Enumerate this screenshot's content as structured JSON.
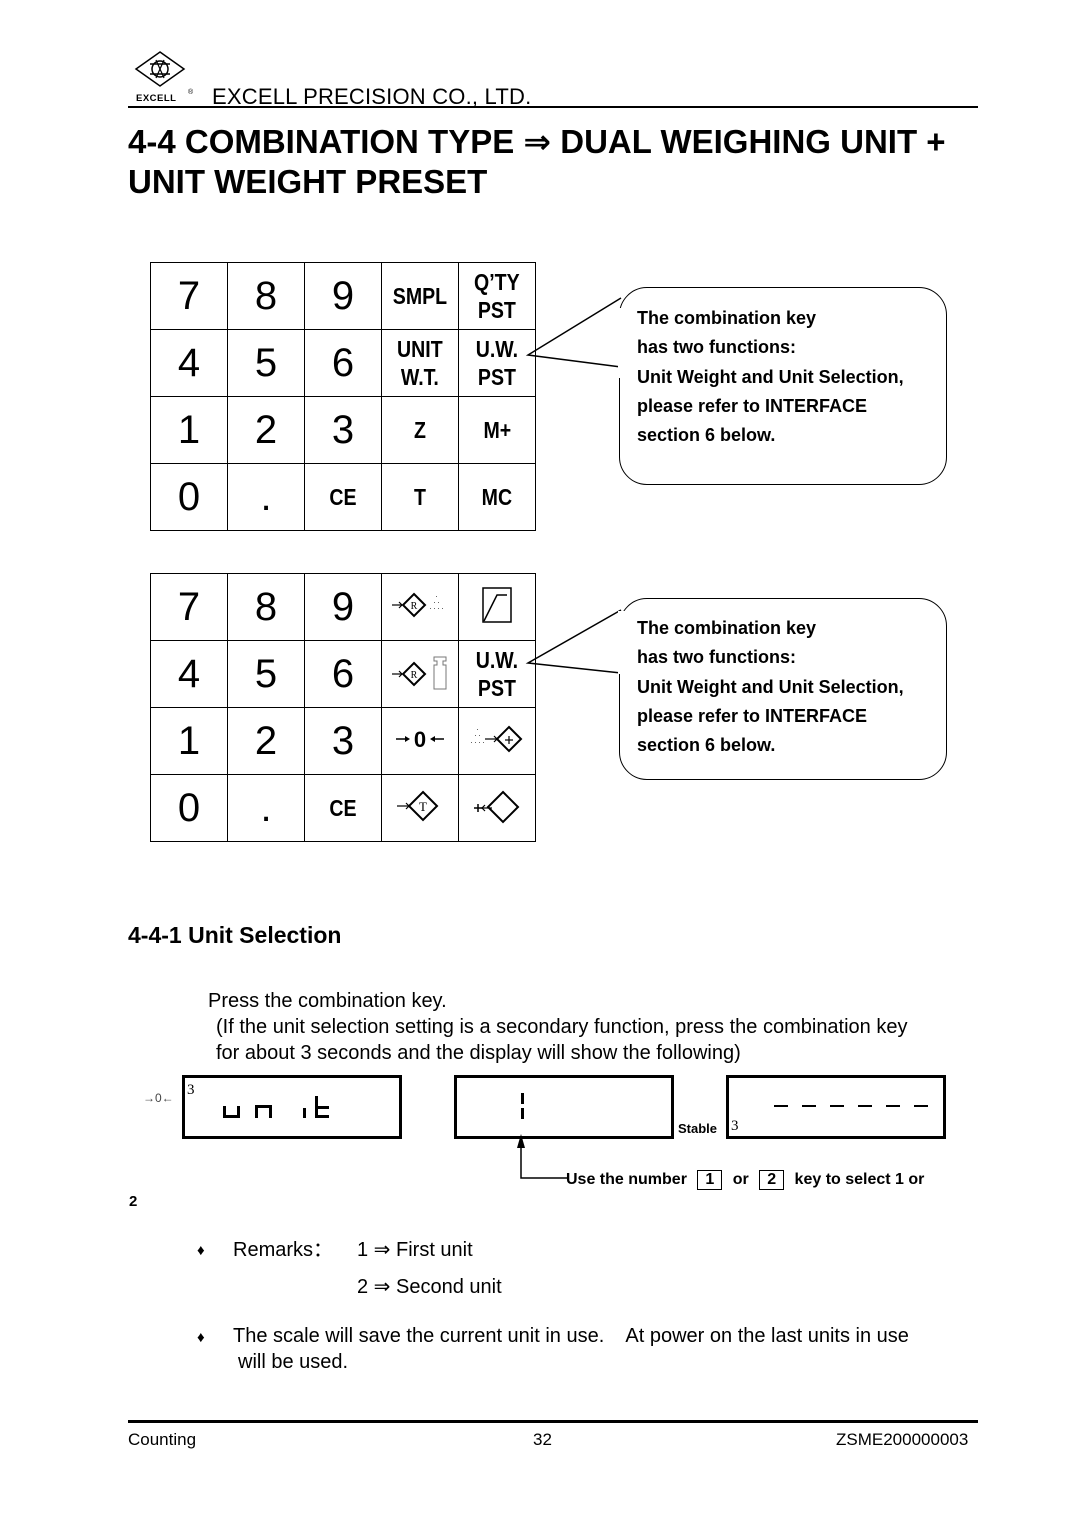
{
  "header": {
    "logo_label": "EXCELL",
    "logo_registered": "®",
    "company": "EXCELL PRECISION CO., LTD."
  },
  "title": "4-4 COMBINATION TYPE ⇒ DUAL WEIGHING UNIT + UNIT WEIGHT PRESET",
  "keypad_text": {
    "rows": [
      [
        "7",
        "8",
        "9",
        "SMPL",
        "Q’TY|PST"
      ],
      [
        "4",
        "5",
        "6",
        "UNIT|W.T.",
        "U.W.|PST"
      ],
      [
        "1",
        "2",
        "3",
        "Z",
        "M+"
      ],
      [
        "0",
        ".",
        "CE",
        "T",
        "MC"
      ]
    ],
    "k_7": "7",
    "k_8": "8",
    "k_9": "9",
    "k_4": "4",
    "k_5": "5",
    "k_6": "6",
    "k_1": "1",
    "k_2": "2",
    "k_3": "3",
    "k_0": "0",
    "k_dot": ".",
    "k_ce": "CE",
    "smpl": "SMPL",
    "qty_line1": "Q’TY",
    "qty_line2": "PST",
    "unit_line1": "UNIT",
    "unit_line2": "W.T.",
    "uw_line1": "U.W.",
    "uw_line2": "PST",
    "z": "Z",
    "mplus": "M+",
    "t": "T",
    "mc": "MC"
  },
  "keypad_icon": {
    "icons": [
      "sample-r-icon",
      "curve-icon",
      "unit-weight-r-icon",
      "zero-icon",
      "accumulate-plus-icon",
      "tare-icon",
      "recall-icon"
    ],
    "k_7": "7",
    "k_8": "8",
    "k_9": "9",
    "k_4": "4",
    "k_5": "5",
    "k_6": "6",
    "k_1": "1",
    "k_2": "2",
    "k_3": "3",
    "k_0": "0",
    "k_dot": ".",
    "k_ce": "CE",
    "uw_line1": "U.W.",
    "uw_line2": "PST",
    "r_letter": "R",
    "t_letter": "T",
    "zero_text": "0"
  },
  "callouts": [
    {
      "lines": [
        "The combination key",
        "has two functions:",
        "Unit Weight and Unit Selection,",
        "please refer to INTERFACE",
        "section 6 below."
      ]
    },
    {
      "lines": [
        "The combination key",
        "has two functions:",
        "Unit Weight and Unit Selection,",
        "please refer to INTERFACE",
        "section 6 below."
      ]
    }
  ],
  "section": {
    "title": "4-4-1 Unit Selection",
    "instruction": "Press the combination key.",
    "note_line1": "(If the unit selection setting is a secondary function, press the combination key",
    "note_line2": "for about 3 seconds and the display will show the following)"
  },
  "displays": {
    "zero_indicator": "→0←",
    "first_corner": "3",
    "first_text": "unit",
    "second_value": "1",
    "stable_label": "Stable",
    "third_corner": "3",
    "third_text": "------"
  },
  "select_note": {
    "prefix": "Use the number",
    "key1": "1",
    "or": "or",
    "key2": "2",
    "suffix": "key to select 1 or",
    "wrap": "2"
  },
  "remarks": {
    "label": "Remarks：",
    "item1": "1 ⇒ First unit",
    "item2": "2 ⇒ Second unit",
    "bullet": "♦"
  },
  "note": {
    "bullet": "♦",
    "line1": "The scale will save the current unit in use.    At power on the last units in use",
    "line2": "will be used."
  },
  "footer": {
    "left": "Counting",
    "center": "32",
    "right": "ZSME200000003"
  }
}
